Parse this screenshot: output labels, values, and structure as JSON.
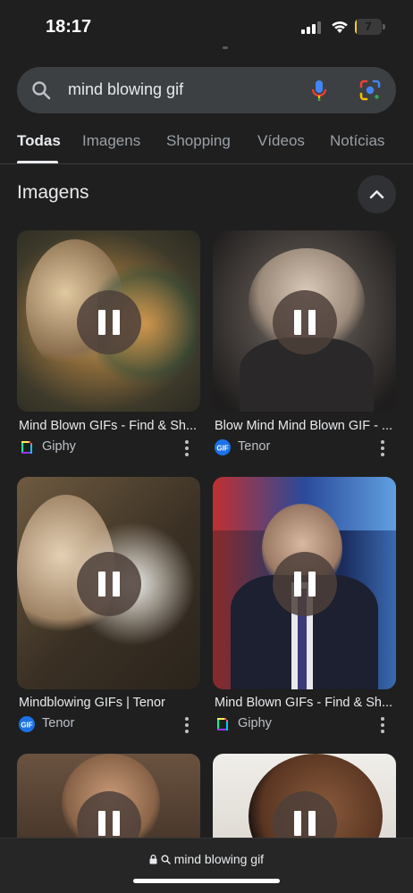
{
  "status_bar": {
    "time": "18:17",
    "battery": "7",
    "battery_level_percent": 7
  },
  "search": {
    "query": "mind blowing gif"
  },
  "tabs": [
    {
      "label": "Todas",
      "active": true
    },
    {
      "label": "Imagens",
      "active": false
    },
    {
      "label": "Shopping",
      "active": false
    },
    {
      "label": "Vídeos",
      "active": false
    },
    {
      "label": "Notícias",
      "active": false
    }
  ],
  "section": {
    "title": "Imagens"
  },
  "cards": [
    {
      "title": "Mind Blown GIFs - Find & Sh...",
      "source": "Giphy",
      "source_icon": "giphy-icon"
    },
    {
      "title": "Blow Mind Mind Blown GIF - ...",
      "source": "Tenor",
      "source_icon": "tenor-icon"
    },
    {
      "title": "Mindblowing GIFs | Tenor",
      "source": "Tenor",
      "source_icon": "tenor-icon"
    },
    {
      "title": "Mind Blown GIFs - Find & Sh...",
      "source": "Giphy",
      "source_icon": "giphy-icon"
    },
    {
      "title": "",
      "source": "",
      "source_icon": ""
    },
    {
      "title": "",
      "source": "",
      "source_icon": ""
    }
  ],
  "bottom_bar": {
    "url": "mind blowing gif"
  },
  "colors": {
    "background": "#1f1f1f",
    "search_bar": "#3c4043",
    "accent_blue": "#1a73e8",
    "battery_yellow": "#f2c94c"
  }
}
